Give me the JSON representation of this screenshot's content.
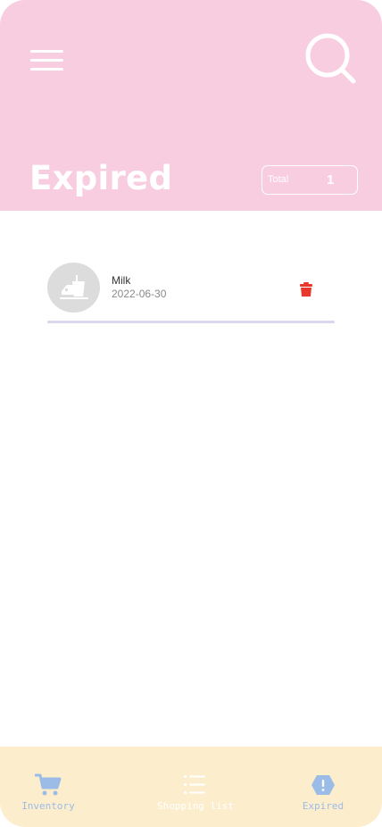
{
  "header": {
    "title": "Expired",
    "total_label": "Total",
    "total_count": "1"
  },
  "items": [
    {
      "name": "Milk",
      "date": "2022-06-30",
      "icon": "food-drink-icon"
    }
  ],
  "bottom_nav": [
    {
      "label": "Inventory",
      "icon": "cart-icon"
    },
    {
      "label": "Shopping list",
      "icon": "list-icon"
    },
    {
      "label": "Expired",
      "icon": "alert-hexagon-icon"
    }
  ],
  "colors": {
    "header_bg": "#f8cde0",
    "nav_bg": "#fcedcc",
    "nav_active": "#9cbce8",
    "delete": "#e8372c",
    "avatar_bg": "#dcdcdc"
  }
}
